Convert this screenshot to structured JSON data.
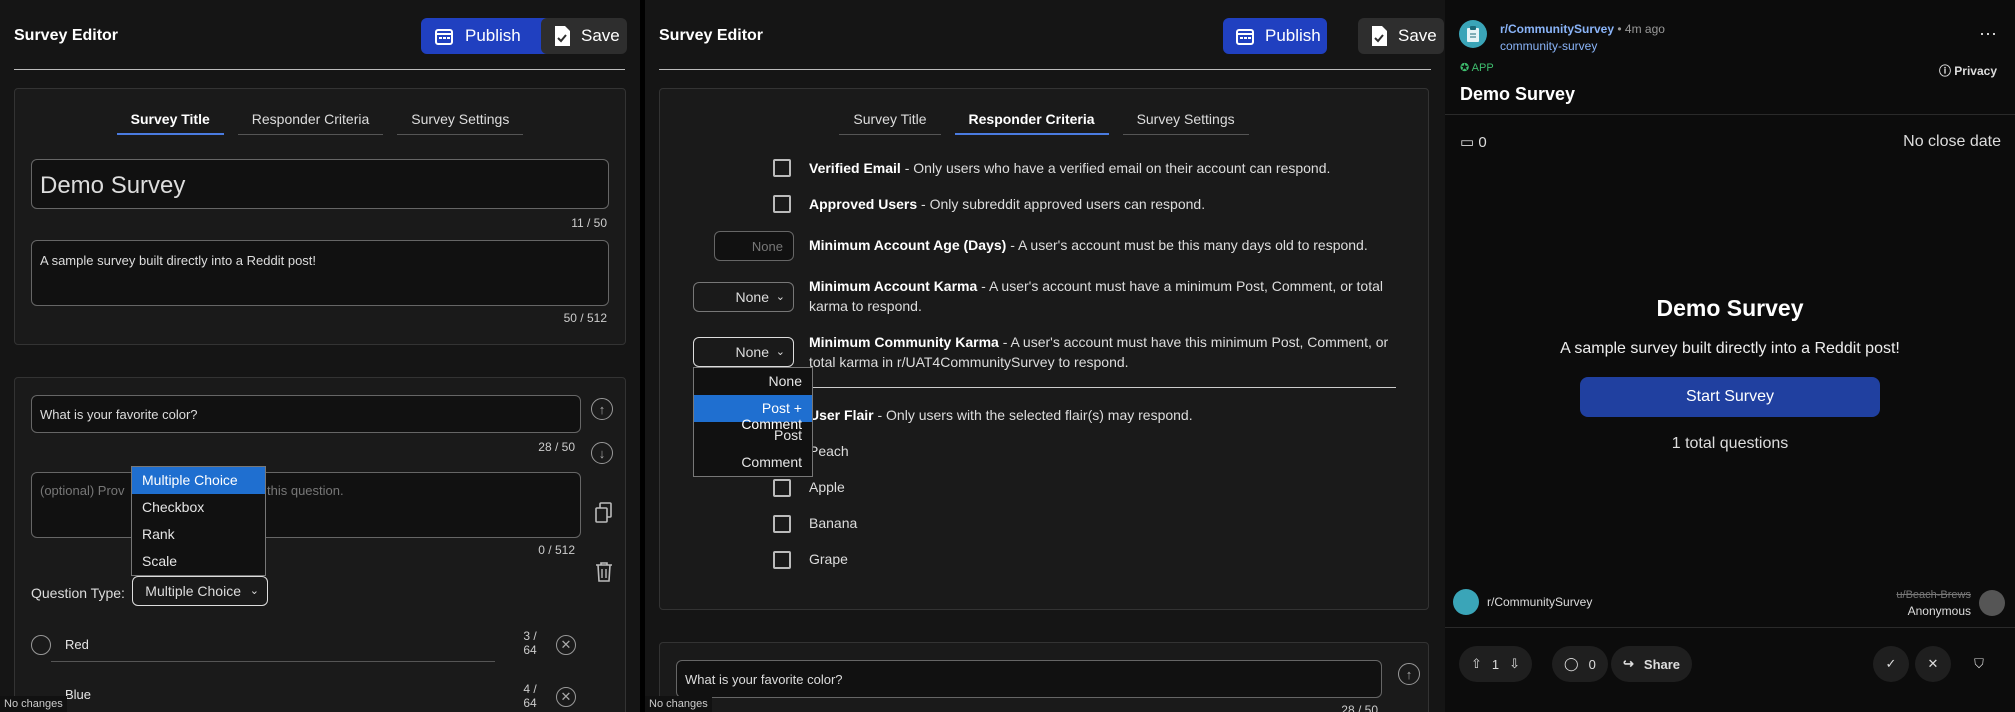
{
  "left": {
    "header_title": "Survey Editor",
    "publish_label": "Publish",
    "save_label": "Save",
    "tabs": [
      "Survey Title",
      "Responder Criteria",
      "Survey Settings"
    ],
    "title_value": "Demo Survey",
    "title_count": "11 / 50",
    "desc_value": "A sample survey built directly into a Reddit post!",
    "desc_count": "50 / 512",
    "question_value": "What is your favorite color?",
    "question_count": "28 / 50",
    "qdesc_placeholder": "(optional) Provide more detail about this question.",
    "qdesc_visible": "(optional) Prov",
    "qdesc_visible_tail": "this question.",
    "qdesc_count": "0 / 512",
    "qtype_label": "Question Type:",
    "qtype_value": "Multiple Choice",
    "qtype_options": [
      "Multiple Choice",
      "Checkbox",
      "Rank",
      "Scale"
    ],
    "options": [
      {
        "value": "Red",
        "count_top": "3 /",
        "count_bottom": "64"
      },
      {
        "value": "Blue",
        "count_top": "4 /",
        "count_bottom": "64"
      }
    ],
    "status": "No changes"
  },
  "mid": {
    "header_title": "Survey Editor",
    "publish_label": "Publish",
    "save_label": "Save",
    "tabs": [
      "Survey Title",
      "Responder Criteria",
      "Survey Settings"
    ],
    "verified_title": "Verified Email",
    "verified_text": " - Only users who have a verified email on their account can respond.",
    "approved_title": "Approved Users",
    "approved_text": " - Only subreddit approved users can respond.",
    "age_placeholder": "None",
    "age_title": "Minimum Account Age (Days)",
    "age_text": " - A user's account must be this many days old to respond.",
    "karma_value": "None",
    "karma_title": "Minimum Account Karma",
    "karma_text": " - A user's account must have a minimum Post, Comment, or total karma to respond.",
    "ckarma_value": "None",
    "ckarma_title": "Minimum Community Karma",
    "ckarma_text": " - A user's account must have this minimum Post, Comment, or total karma in r/UAT4CommunitySurvey to respond.",
    "ckarma_options": [
      "None",
      "Post + Comment",
      "Post",
      "Comment"
    ],
    "flair_title": "User Flair",
    "flair_text": " - Only users with the selected flair(s) may respond.",
    "flairs": [
      "Peach",
      "Apple",
      "Banana",
      "Grape"
    ],
    "question_value": "What is your favorite color?",
    "question_count": "28 / 50",
    "status": "No changes"
  },
  "post": {
    "subreddit": "r/CommunitySurvey",
    "time": "• 4m ago",
    "app_name": "community-survey",
    "app_badge": "APP",
    "privacy": "Privacy",
    "title": "Demo Survey",
    "responses": "0",
    "close_date": "No close date",
    "survey_title": "Demo Survey",
    "survey_desc": "A sample survey built directly into a Reddit post!",
    "start_label": "Start Survey",
    "total": "1 total questions",
    "footer_sub": "r/CommunitySurvey",
    "footer_user": "u/Beach-Brews",
    "footer_anon": "Anonymous",
    "votes": "1",
    "comments": "0",
    "share": "Share"
  }
}
